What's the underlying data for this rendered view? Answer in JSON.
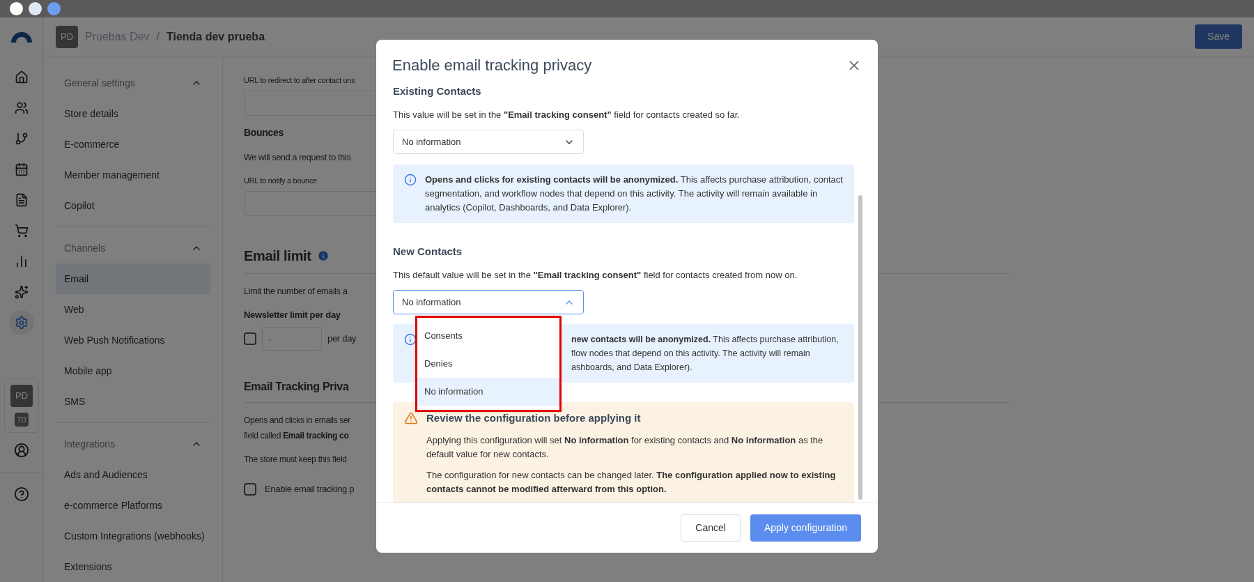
{
  "header": {
    "avatar": "PD",
    "breadcrumb": [
      "Pruebas Dev",
      "Tienda dev prueba"
    ],
    "separator": "/",
    "save": "Save"
  },
  "rail": {
    "items": [
      {
        "selected": false
      },
      {
        "selected": false
      },
      {
        "selected": false
      },
      {
        "selected": false
      },
      {
        "selected": false
      },
      {
        "selected": false
      },
      {
        "selected": false
      },
      {
        "selected": false
      },
      {
        "selected": true
      }
    ],
    "accounts": [
      "PD",
      "TD"
    ]
  },
  "settings_nav": {
    "sections": [
      {
        "title": "General settings",
        "expanded": true,
        "items": [
          {
            "label": "Store details",
            "selected": false
          },
          {
            "label": "E-commerce",
            "selected": false
          },
          {
            "label": "Member management",
            "selected": false
          },
          {
            "label": "Copilot",
            "selected": false
          }
        ]
      },
      {
        "title": "Channels",
        "expanded": true,
        "items": [
          {
            "label": "Email",
            "selected": true
          },
          {
            "label": "Web",
            "selected": false
          },
          {
            "label": "Web Push Notifications",
            "selected": false
          },
          {
            "label": "Mobile app",
            "selected": false
          },
          {
            "label": "SMS",
            "selected": false
          }
        ]
      },
      {
        "title": "Integrations",
        "expanded": true,
        "items": [
          {
            "label": "Ads and Audiences",
            "selected": false
          },
          {
            "label": "e-commerce Platforms",
            "selected": false
          },
          {
            "label": "Custom Integrations (webhooks)",
            "selected": false
          },
          {
            "label": "Extensions",
            "selected": false
          }
        ]
      }
    ]
  },
  "content": {
    "redirect_label": "URL to redirect to after contact uns",
    "bounces_title": "Bounces",
    "bounces_text": "We will send a request to this",
    "bounce_label": "URL to notify a bounce",
    "email_limit": {
      "title": "Email limit",
      "text": "Limit the number of emails a",
      "field_label": "Newsletter limit per day",
      "checked": false,
      "placeholder": "-",
      "unit": "per day"
    },
    "tracking": {
      "title": "Email Tracking Priva",
      "lines": [
        "Opens and clicks in emails ser",
        "field called **Email tracking co**"
      ],
      "note": "The store must keep this field",
      "checkbox_label": "Enable email tracking p",
      "checked": false
    }
  },
  "modal": {
    "title": "Enable email tracking privacy",
    "existing": {
      "title": "Existing Contacts",
      "description": "This value will be set in the **\"Email tracking consent\"** field for contacts created so far.",
      "value": "No information",
      "open": false,
      "info": "**Opens and clicks for existing contacts will be anonymized.** This affects purchase attribution, contact segmentation, and workflow nodes that depend on this activity. The activity will remain available in analytics (Copilot, Dashboards, and Data Explorer)."
    },
    "new": {
      "title": "New Contacts",
      "description": "This default value will be set in the **\"Email tracking consent\"** field for contacts created from now on.",
      "value": "No information",
      "open": true,
      "options": [
        {
          "label": "Consents",
          "selected": false
        },
        {
          "label": "Denies",
          "selected": false
        },
        {
          "label": "No information",
          "selected": true
        }
      ],
      "info_lines": [
        "**new contacts will be anonymized.** This affects purchase attribution,",
        "flow nodes that depend on this activity. The activity will remain",
        "ashboards, and Data Explorer)."
      ]
    },
    "warning": {
      "title": "Review the configuration before applying it",
      "paragraphs": [
        "Applying this configuration will set **No information** for existing contacts and **No information** as the default value for new contacts.",
        "The configuration for new contacts can be changed later. **The configuration applied now to existing contacts cannot be modified afterward from this option.**"
      ]
    },
    "cancel": "Cancel",
    "apply": "Apply configuration"
  }
}
